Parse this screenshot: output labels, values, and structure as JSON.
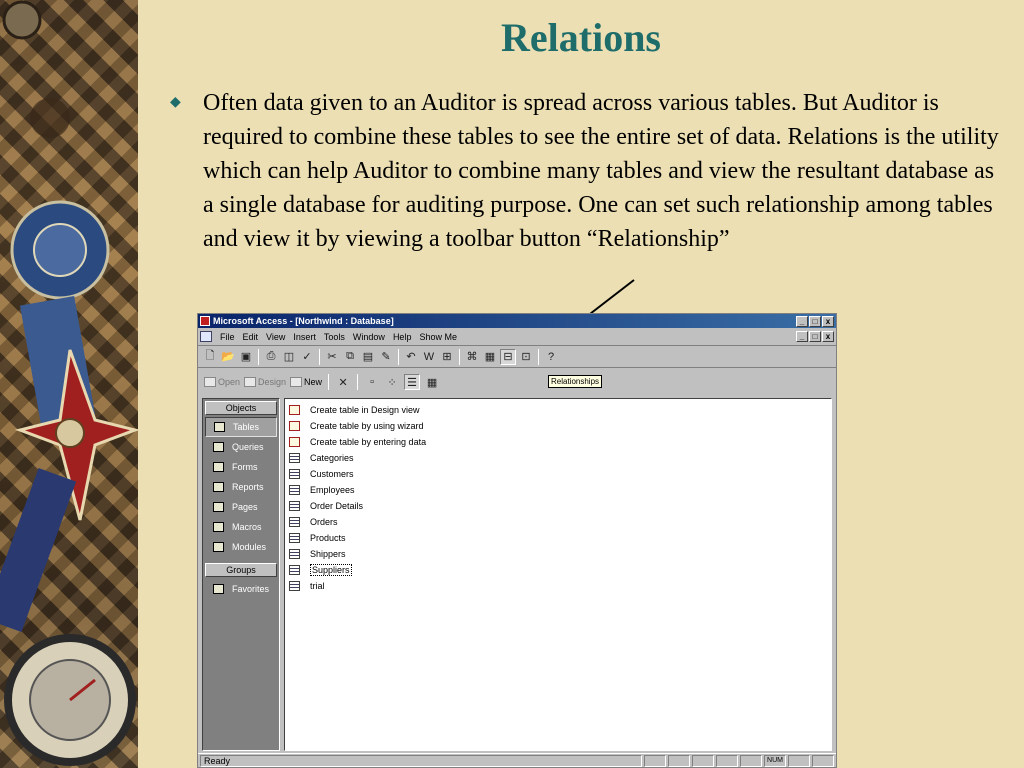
{
  "slide": {
    "title": "Relations",
    "bullet_text": "Often data given to an Auditor is spread across various tables. But Auditor is required to combine these tables to see the entire set of data. Relations is the utility which can help Auditor to combine many tables and view the resultant database as a single database for auditing purpose. One can set such relationship among tables and view it by viewing a toolbar button “Relationship”"
  },
  "colors": {
    "title": "#1f6d6b",
    "background": "#ecdfb4",
    "titlebar": "#0a246a"
  },
  "window": {
    "title": "Microsoft Access - [Northwind : Database]",
    "controls": [
      "_",
      "□",
      "x"
    ]
  },
  "menu": [
    "File",
    "Edit",
    "View",
    "Insert",
    "Tools",
    "Window",
    "Help",
    "Show Me"
  ],
  "tooltip": "Relationships",
  "db_toolbar": {
    "open": "Open",
    "design": "Design",
    "new": "New"
  },
  "objects": {
    "header": "Objects",
    "items": [
      "Tables",
      "Queries",
      "Forms",
      "Reports",
      "Pages",
      "Macros",
      "Modules"
    ],
    "selected": "Tables",
    "groups_header": "Groups",
    "groups": [
      "Favorites"
    ]
  },
  "tables": {
    "wizards": [
      "Create table in Design view",
      "Create table by using wizard",
      "Create table by entering data"
    ],
    "items": [
      "Categories",
      "Customers",
      "Employees",
      "Order Details",
      "Orders",
      "Products",
      "Shippers",
      "Suppliers",
      "trial"
    ],
    "focused": "Suppliers"
  },
  "status": {
    "text": "Ready",
    "num": "NUM"
  }
}
